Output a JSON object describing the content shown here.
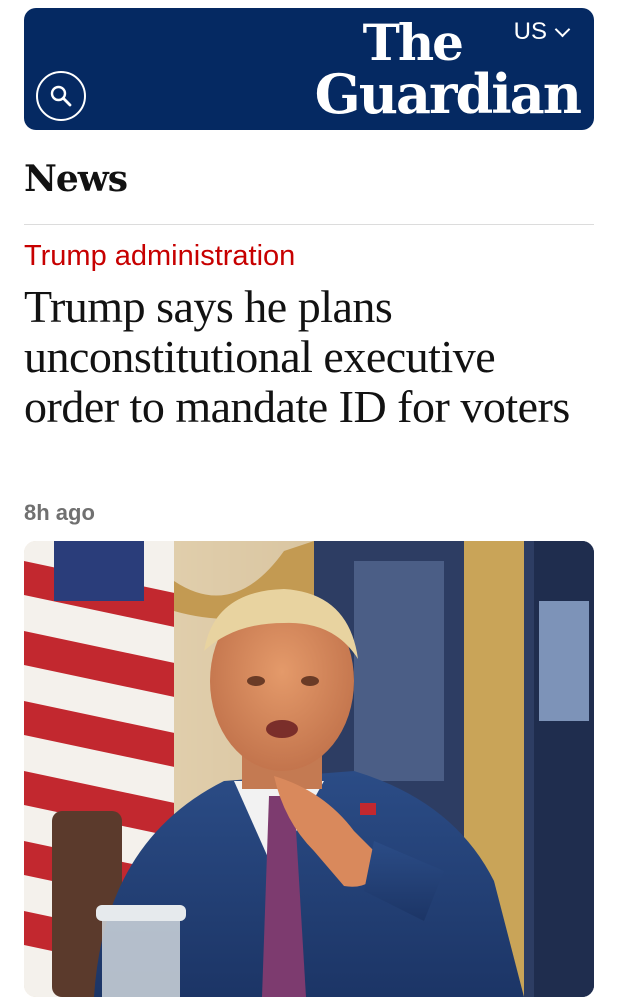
{
  "masthead": {
    "logo_line1": "The",
    "logo_line2": "Guardian",
    "edition": "US",
    "background_color": "#052962"
  },
  "icons": {
    "search": "search-icon",
    "edition_chevron": "chevron-down-icon"
  },
  "section": {
    "title": "News"
  },
  "article": {
    "kicker": "Trump administration",
    "kicker_color": "#c70000",
    "headline": "Trump says he plans unconstitutional executive order to mandate ID for voters",
    "timestamp": "8h ago",
    "image_alt": "Donald Trump in a blue suit and purple tie pointing, with American flags in the background"
  }
}
